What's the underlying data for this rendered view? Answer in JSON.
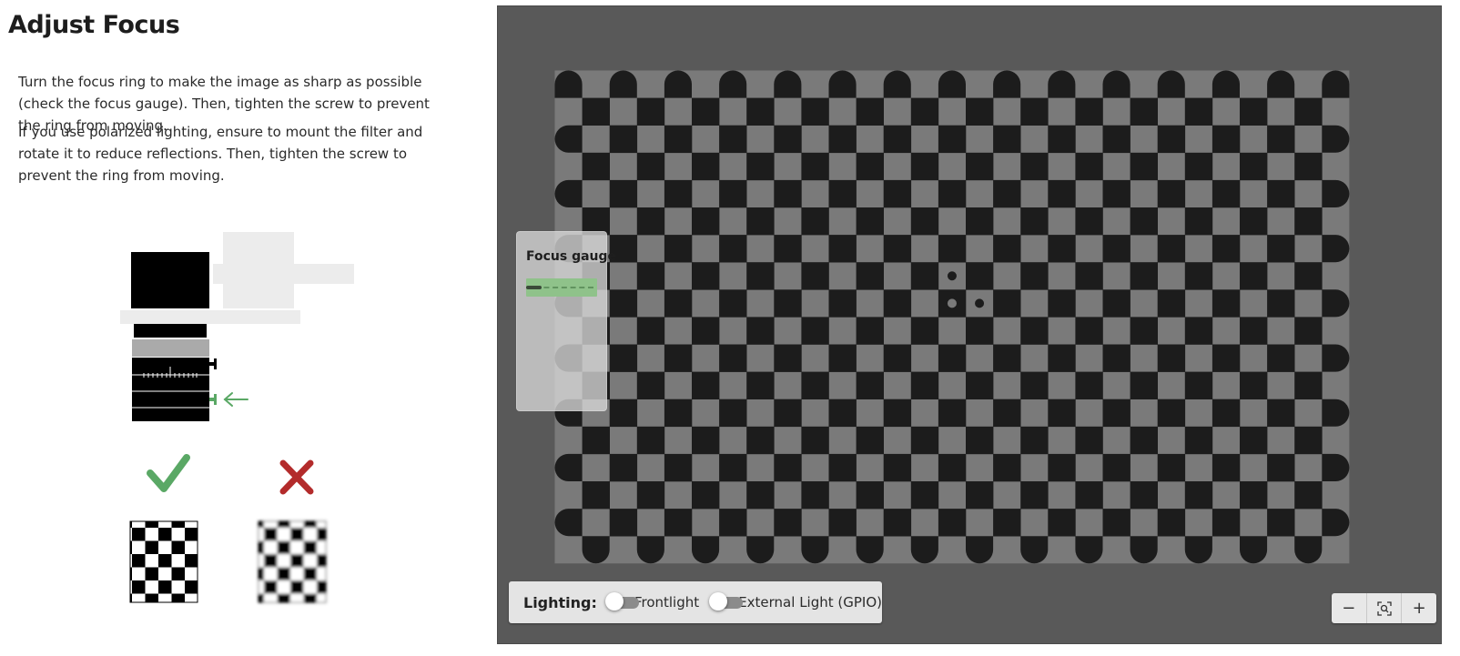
{
  "page": {
    "title": "Adjust Focus",
    "paragraph_1": "Turn the focus ring to make the image as sharp as possible (check the focus gauge). Then, tighten the screw to prevent the ring from moving.",
    "paragraph_2": "If you use polarized lighting, ensure to mount the filter and rotate it to reduce reflections. Then, tighten the screw to prevent the ring from moving."
  },
  "illustration": {
    "correct_icon": "checkmark-icon",
    "incorrect_icon": "cross-icon",
    "arrow_icon": "arrow-left-icon",
    "colors": {
      "correct": "#5aa865",
      "incorrect": "#b32b2b",
      "arrow": "#5aa865"
    }
  },
  "focus_gauge": {
    "title": "Focus gauge",
    "level": 0.22,
    "colors": {
      "bar": "#8fc28a",
      "fill": "#3b4a39"
    }
  },
  "lighting": {
    "label": "Lighting:",
    "toggles": [
      {
        "label": "Frontlight",
        "on": false
      },
      {
        "label": "External Light (GPIO)",
        "on": false
      }
    ]
  },
  "zoom": {
    "out_label": "−",
    "fit_icon": "zoom-fit-icon",
    "in_label": "+"
  }
}
